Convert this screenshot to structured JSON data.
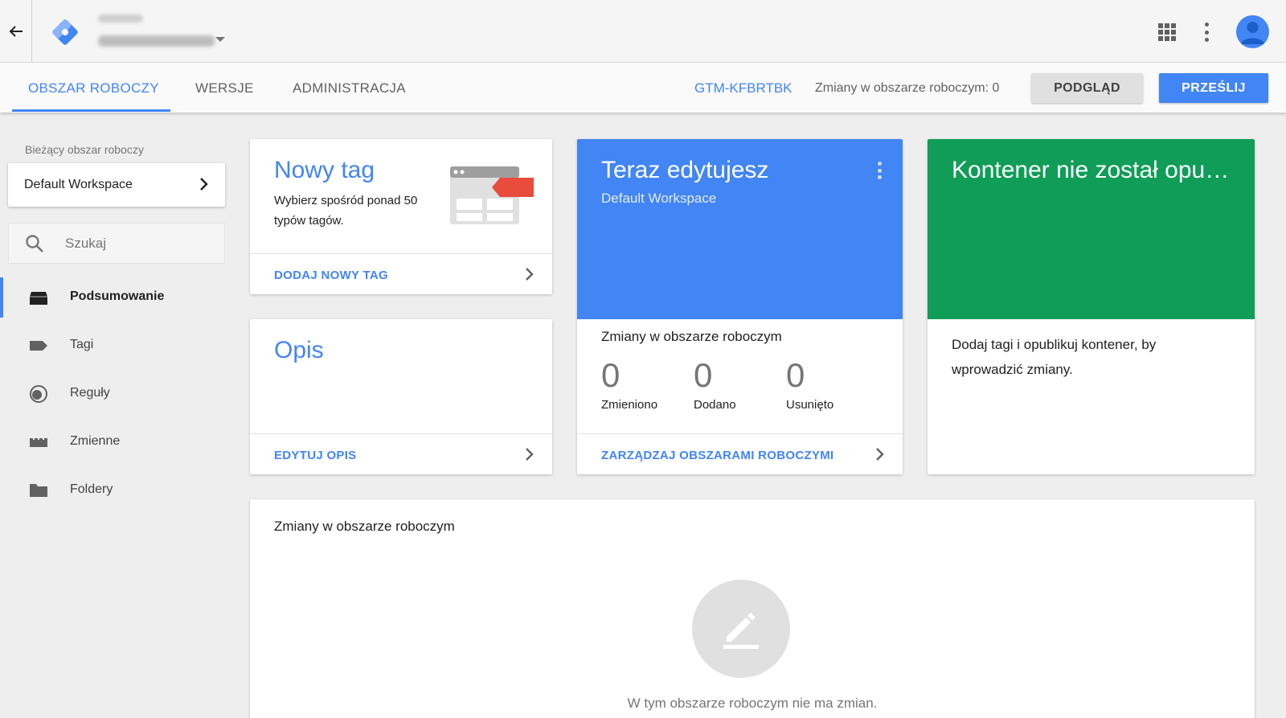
{
  "topbar": {
    "back_icon": "arrow-left-icon",
    "logo_icon": "tag-manager-logo",
    "apps_icon": "apps-grid-icon",
    "more_icon": "more-vert-icon",
    "avatar_icon": "account-avatar"
  },
  "nav": {
    "tabs": [
      {
        "label": "OBSZAR ROBOCZY",
        "active": true
      },
      {
        "label": "WERSJE",
        "active": false
      },
      {
        "label": "ADMINISTRACJA",
        "active": false
      }
    ],
    "container_id": "GTM-KFBRTBK",
    "changes_count": "Zmiany w obszarze roboczym: 0",
    "preview_label": "PODGLĄD",
    "submit_label": "PRZEŚLIJ"
  },
  "sidebar": {
    "workspace_caption": "Bieżący obszar roboczy",
    "workspace_name": "Default Workspace",
    "search_placeholder": "Szukaj",
    "items": [
      {
        "label": "Podsumowanie",
        "icon": "overview-icon",
        "active": true
      },
      {
        "label": "Tagi",
        "icon": "tag-icon",
        "active": false
      },
      {
        "label": "Reguły",
        "icon": "trigger-icon",
        "active": false
      },
      {
        "label": "Zmienne",
        "icon": "variables-icon",
        "active": false
      },
      {
        "label": "Foldery",
        "icon": "folder-icon",
        "active": false
      }
    ]
  },
  "cards": {
    "new_tag": {
      "title": "Nowy tag",
      "description": "Wybierz spośród ponad 50 typów tagów.",
      "link": "DODAJ NOWY TAG"
    },
    "description": {
      "title": "Opis",
      "link": "EDYTUJ OPIS"
    },
    "editing": {
      "title": "Teraz edytujesz",
      "subtitle": "Default Workspace",
      "changes_title": "Zmiany w obszarze roboczym",
      "stats": [
        {
          "value": "0",
          "label": "Zmieniono"
        },
        {
          "value": "0",
          "label": "Dodano"
        },
        {
          "value": "0",
          "label": "Usunięto"
        }
      ],
      "link": "ZARZĄDZAJ OBSZARAMI ROBOCZYMI",
      "color": "#4285f4"
    },
    "unpublished": {
      "title": "Kontener nie został opu…",
      "text": "Dodaj tagi i opublikuj kontener, by wprowadzić zmiany.",
      "color": "#0f9d58"
    }
  },
  "changes_panel": {
    "title": "Zmiany w obszarze roboczym",
    "empty_icon": "edit-pencil-icon",
    "empty_text": "W tym obszarze roboczym nie ma zmian."
  },
  "colors": {
    "accent": "#4285f4",
    "success": "#0f9d58",
    "tag_red": "#e94b3c"
  }
}
